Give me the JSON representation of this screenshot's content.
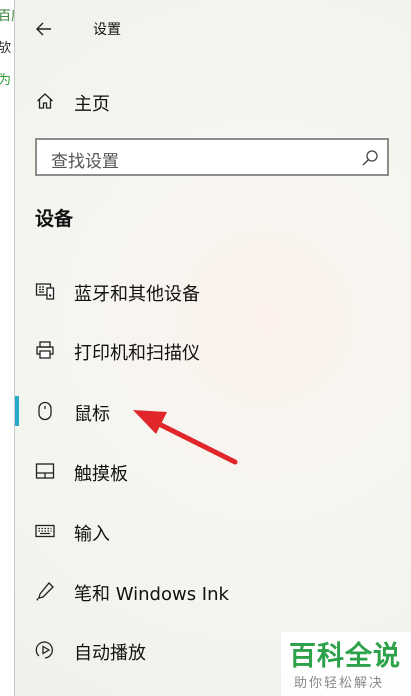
{
  "background_window": {
    "fragments": [
      "百度",
      "欤",
      "为"
    ],
    "fragment_colors": [
      "#2e7d32",
      "#222222",
      "#2e9e3a"
    ]
  },
  "titlebar": {
    "back_icon": "back-arrow-icon",
    "title": "设置"
  },
  "home": {
    "icon": "home-icon",
    "label": "主页"
  },
  "search": {
    "placeholder": "查找设置",
    "icon": "search-icon"
  },
  "section_title": "设备",
  "nav": {
    "items": [
      {
        "label": "蓝牙和其他设备",
        "icon": "bluetooth-devices-icon",
        "selected": false
      },
      {
        "label": "打印机和扫描仪",
        "icon": "printer-icon",
        "selected": false
      },
      {
        "label": "鼠标",
        "icon": "mouse-icon",
        "selected": true
      },
      {
        "label": "触摸板",
        "icon": "touchpad-icon",
        "selected": false
      },
      {
        "label": "输入",
        "icon": "keyboard-icon",
        "selected": false
      },
      {
        "label": "笔和 Windows Ink",
        "icon": "pen-icon",
        "selected": false
      },
      {
        "label": "自动播放",
        "icon": "autoplay-icon",
        "selected": false
      }
    ]
  },
  "accent_color": "#2aa7c9",
  "annotation_arrow_color": "#e0262a",
  "watermark": {
    "title": "百科全说",
    "subtitle": "助你轻松解决",
    "color": "#2da24a"
  }
}
